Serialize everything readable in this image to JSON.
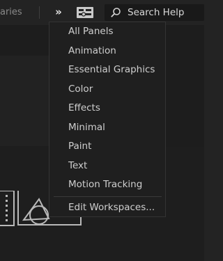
{
  "tabs": {
    "libraries_fragment": "aries"
  },
  "toolbar": {
    "overflow_label": "»",
    "search_placeholder": "Search Help"
  },
  "menu": {
    "items": [
      "All Panels",
      "Animation",
      "Essential Graphics",
      "Color",
      "Effects",
      "Minimal",
      "Paint",
      "Text",
      "Motion Tracking"
    ],
    "footer_item": "Edit Workspaces..."
  }
}
